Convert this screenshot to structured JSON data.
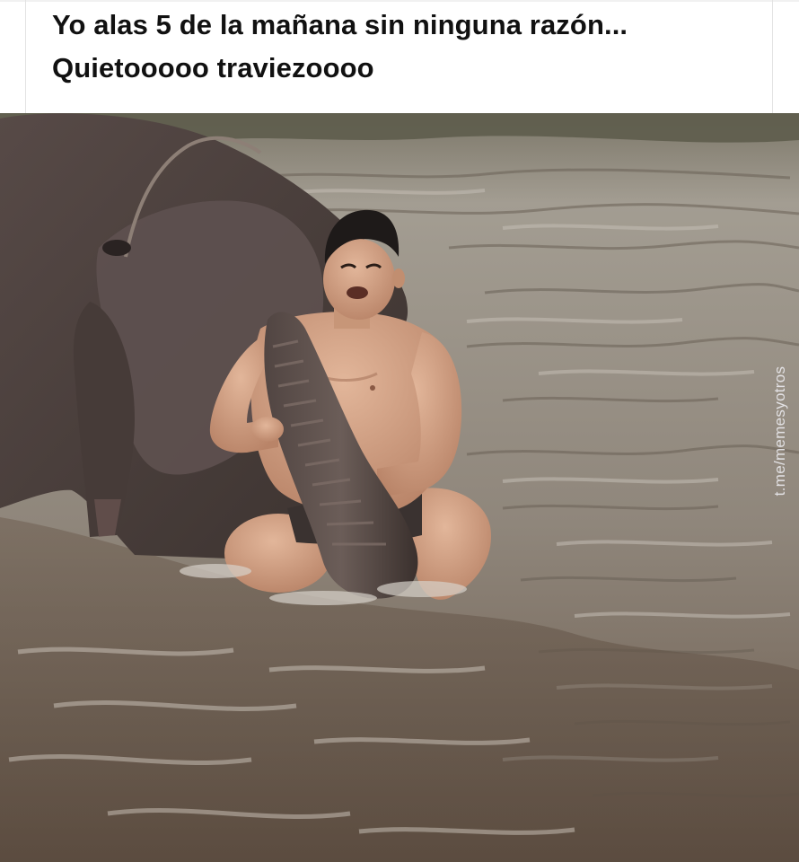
{
  "caption": {
    "line1": "Yo alas 5 de la mañana sin ninguna razón...",
    "line2": "Quietooooo traviezoooo"
  },
  "watermark": {
    "text": "t.me/memesyotros"
  },
  "photo": {
    "subject": "man-with-elephant-in-river",
    "palette": {
      "water_light": "#a8a29b",
      "water_mid": "#8a7f74",
      "water_dark": "#5a4a3d",
      "elephant": "#4d4240",
      "skin": "#d3a384",
      "hair": "#1e1a19"
    }
  }
}
